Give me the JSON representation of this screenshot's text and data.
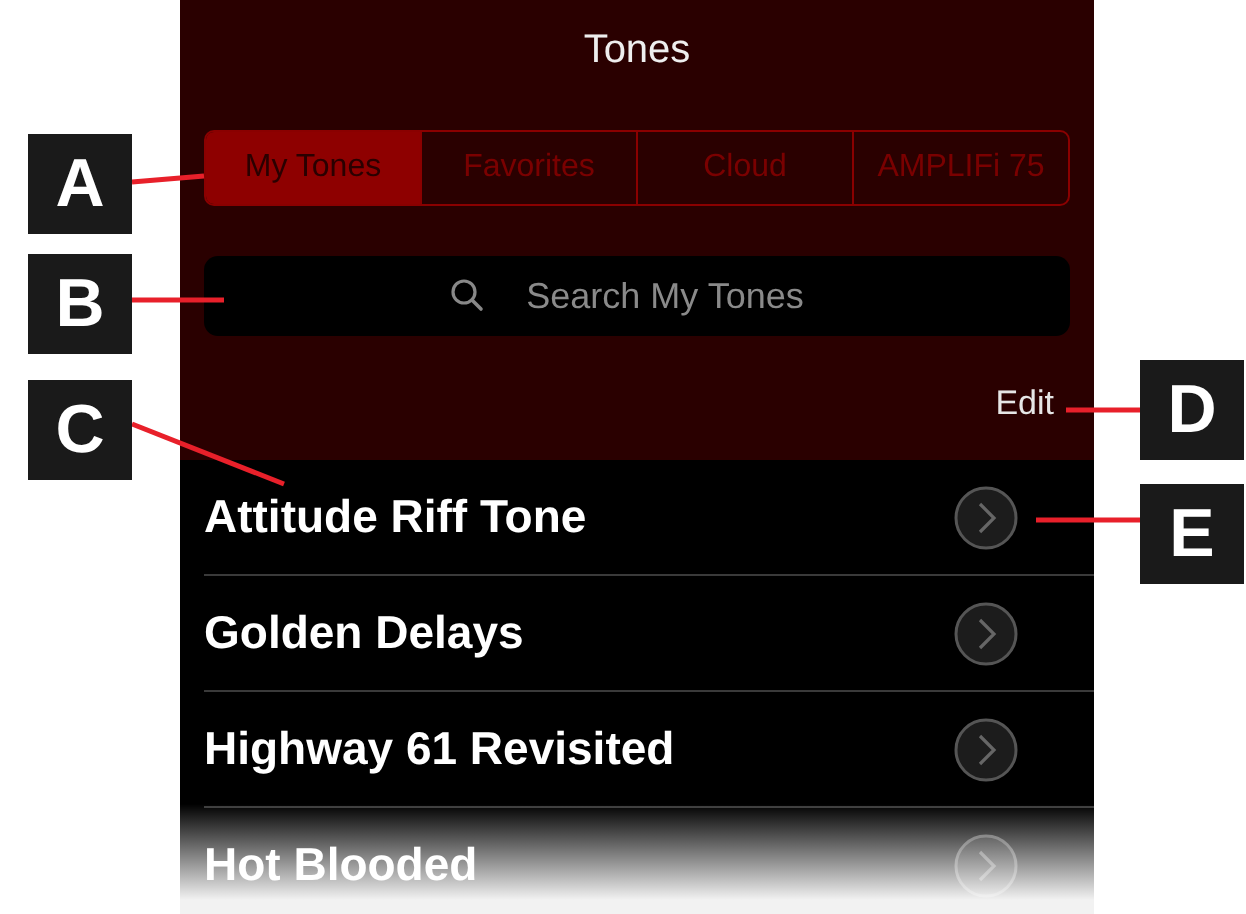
{
  "header": {
    "title": "Tones"
  },
  "tabs": [
    {
      "label": "My Tones",
      "selected": true
    },
    {
      "label": "Favorites",
      "selected": false
    },
    {
      "label": "Cloud",
      "selected": false
    },
    {
      "label": "AMPLIFi 75",
      "selected": false
    }
  ],
  "search": {
    "placeholder": "Search My Tones"
  },
  "edit_button": "Edit",
  "tones": [
    {
      "name": "Attitude Riff Tone"
    },
    {
      "name": "Golden Delays"
    },
    {
      "name": "Highway 61 Revisited"
    },
    {
      "name": "Hot Blooded"
    }
  ],
  "callouts": [
    {
      "label": "A"
    },
    {
      "label": "B"
    },
    {
      "label": "C"
    },
    {
      "label": "D"
    },
    {
      "label": "E"
    }
  ]
}
